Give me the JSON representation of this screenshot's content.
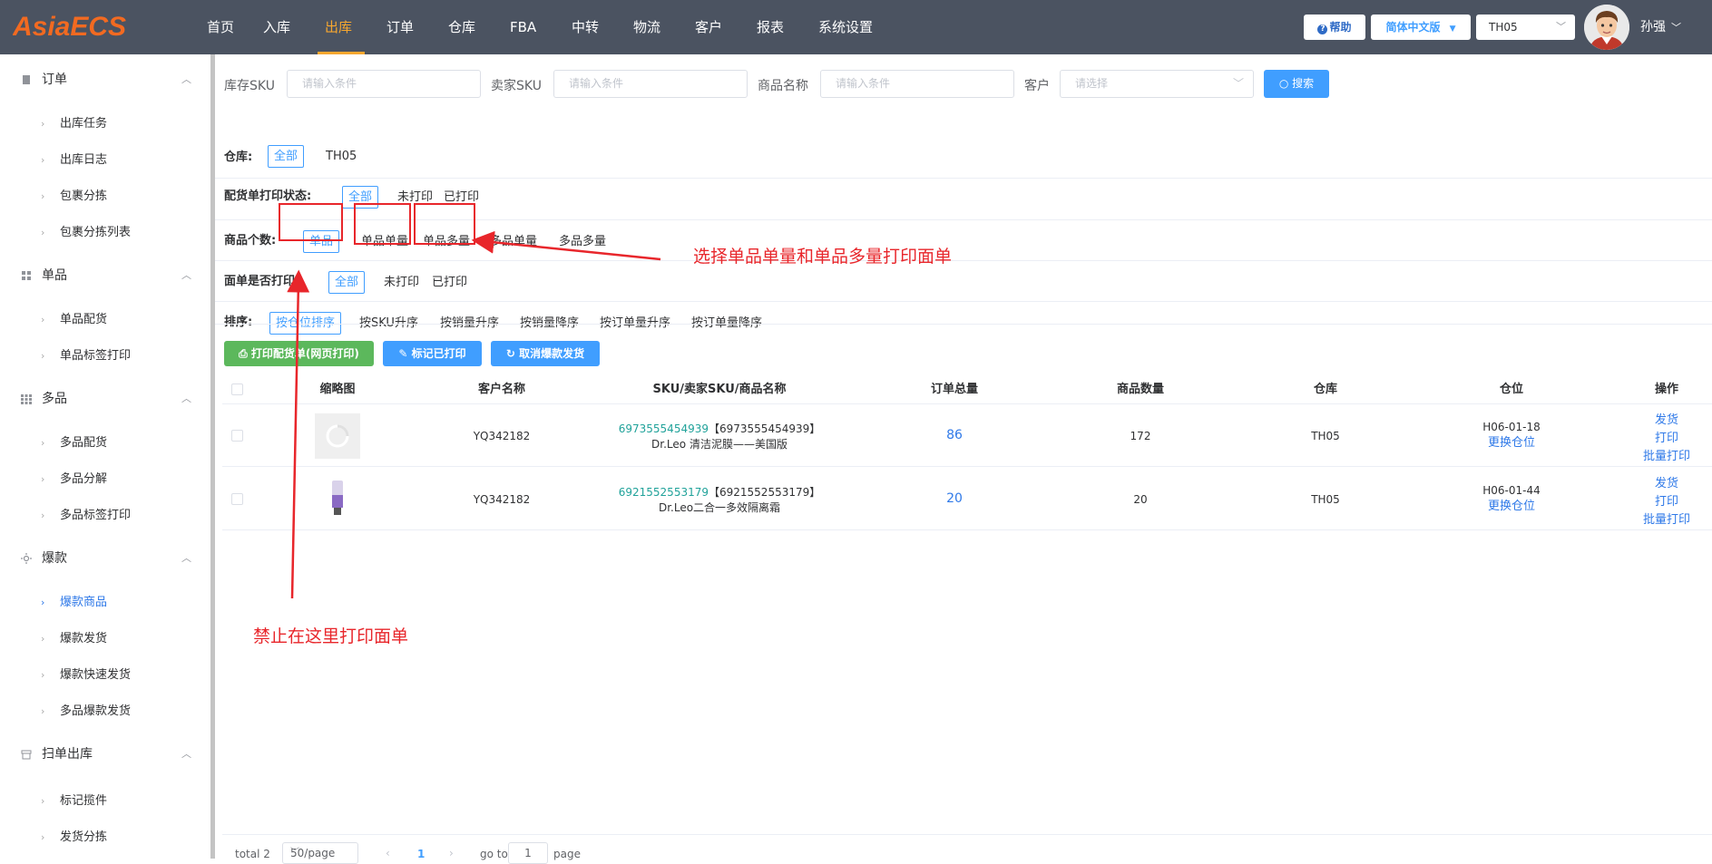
{
  "header": {
    "logo_text": "AsiaECS",
    "nav": [
      "首页",
      "入库",
      "出库",
      "订单",
      "仓库",
      "FBA",
      "中转",
      "物流",
      "客户",
      "报表",
      "系统设置"
    ],
    "nav_active": "出库",
    "help_label": "帮助",
    "language_label": "简体中文版",
    "warehouse_value": "TH05",
    "username": "孙强"
  },
  "sidebar": {
    "groups": [
      {
        "label": "订单",
        "icon": "document-icon",
        "items": [
          "出库任务",
          "出库日志",
          "包裹分拣",
          "包裹分拣列表"
        ]
      },
      {
        "label": "单品",
        "icon": "grid-icon",
        "items": [
          "单品配货",
          "单品标签打印"
        ]
      },
      {
        "label": "多品",
        "icon": "apps-icon",
        "items": [
          "多品配货",
          "多品分解",
          "多品标签打印"
        ]
      },
      {
        "label": "爆款",
        "icon": "sun-icon",
        "items": [
          "爆款商品",
          "爆款发货",
          "爆款快速发货",
          "多品爆款发货"
        ]
      },
      {
        "label": "扫单出库",
        "icon": "box-icon",
        "items": [
          "标记揽件",
          "发货分拣"
        ]
      }
    ],
    "active_item": "爆款商品"
  },
  "search": {
    "stock_sku_label": "库存SKU",
    "stock_sku_placeholder": "请输入条件",
    "seller_sku_label": "卖家SKU",
    "seller_sku_placeholder": "请输入条件",
    "product_name_label": "商品名称",
    "product_name_placeholder": "请输入条件",
    "customer_label": "客户",
    "customer_placeholder": "请选择",
    "search_button": "搜索"
  },
  "filters": {
    "warehouse": {
      "label": "仓库:",
      "options": [
        "全部",
        "TH05"
      ],
      "active": "全部"
    },
    "pick_print": {
      "label": "配货单打印状态:",
      "options": [
        "全部",
        "未打印",
        "已打印"
      ],
      "active": "全部"
    },
    "item_count": {
      "label": "商品个数:",
      "options": [
        "单品",
        "单品单量",
        "单品多量",
        "多品单量",
        "多品多量"
      ],
      "active": "单品"
    },
    "label_print": {
      "label": "面单是否打印:",
      "options": [
        "全部",
        "未打印",
        "已打印"
      ],
      "active": "全部"
    },
    "sort": {
      "label": "排序:",
      "options": [
        "按仓位排序",
        "按SKU升序",
        "按销量升序",
        "按销量降序",
        "按订单量升序",
        "按订单量降序"
      ],
      "active": "按仓位排序"
    }
  },
  "actions": {
    "print_pick": "打印配货单(网页打印)",
    "mark_printed": "标记已打印",
    "cancel_hot": "取消爆款发货"
  },
  "table": {
    "columns": [
      "缩略图",
      "客户名称",
      "SKU/卖家SKU/商品名称",
      "订单总量",
      "商品数量",
      "仓库",
      "仓位",
      "操作"
    ],
    "rows": [
      {
        "customer": "YQ342182",
        "sku": "6973555454939",
        "seller_sku": "【6973555454939】",
        "name": "Dr.Leo 清洁泥膜——美国版",
        "orders": "86",
        "qty": "172",
        "warehouse": "TH05",
        "location": "H06-01-18",
        "change_loc": "更换仓位",
        "ops": [
          "发货",
          "打印",
          "批量打印"
        ]
      },
      {
        "customer": "YQ342182",
        "sku": "6921552553179",
        "seller_sku": "【6921552553179】",
        "name": "Dr.Leo二合一多效隔离霜",
        "orders": "20",
        "qty": "20",
        "warehouse": "TH05",
        "location": "H06-01-44",
        "change_loc": "更换仓位",
        "ops": [
          "发货",
          "打印",
          "批量打印"
        ]
      }
    ]
  },
  "pagination": {
    "total": "total 2",
    "page_size": "50/page",
    "current": "1",
    "goto_label": "go to",
    "goto_value": "1",
    "page_label": "page"
  },
  "annotations": {
    "select_note": "选择单品单量和单品多量打印面单",
    "forbid_note": "禁止在这里打印面单"
  },
  "colors": {
    "topbar": "#4b5361",
    "accent": "#409eff",
    "nav_active": "#f7a72f",
    "annotation": "#e8262b",
    "green": "#5cb85c"
  }
}
